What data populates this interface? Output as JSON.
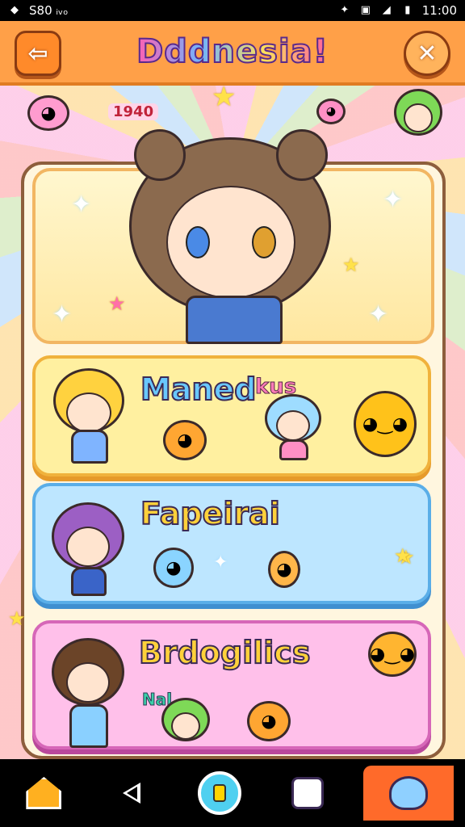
{
  "status_bar": {
    "left_text": "S80 ᵢᵥₒ",
    "time": "11:00"
  },
  "header": {
    "title": "Dddnesia!",
    "back_label": "⇦",
    "close_label": "✕"
  },
  "hero": {
    "tag": "1940"
  },
  "cards": [
    {
      "title": "Maned",
      "subtitle": "kus",
      "color": "#fff0a0"
    },
    {
      "title": "Fapeirai",
      "color": "#bde6ff"
    },
    {
      "title": "Brdogilics",
      "subtitle": "Nal",
      "color": "#ffc0ea"
    }
  ],
  "icons": {
    "back": "arrow-left-icon",
    "close": "close-icon",
    "home": "house-icon",
    "nav_back": "triangle-back-icon",
    "center": "capsule-icon",
    "robot": "robot-icon",
    "pet": "creature-icon"
  }
}
